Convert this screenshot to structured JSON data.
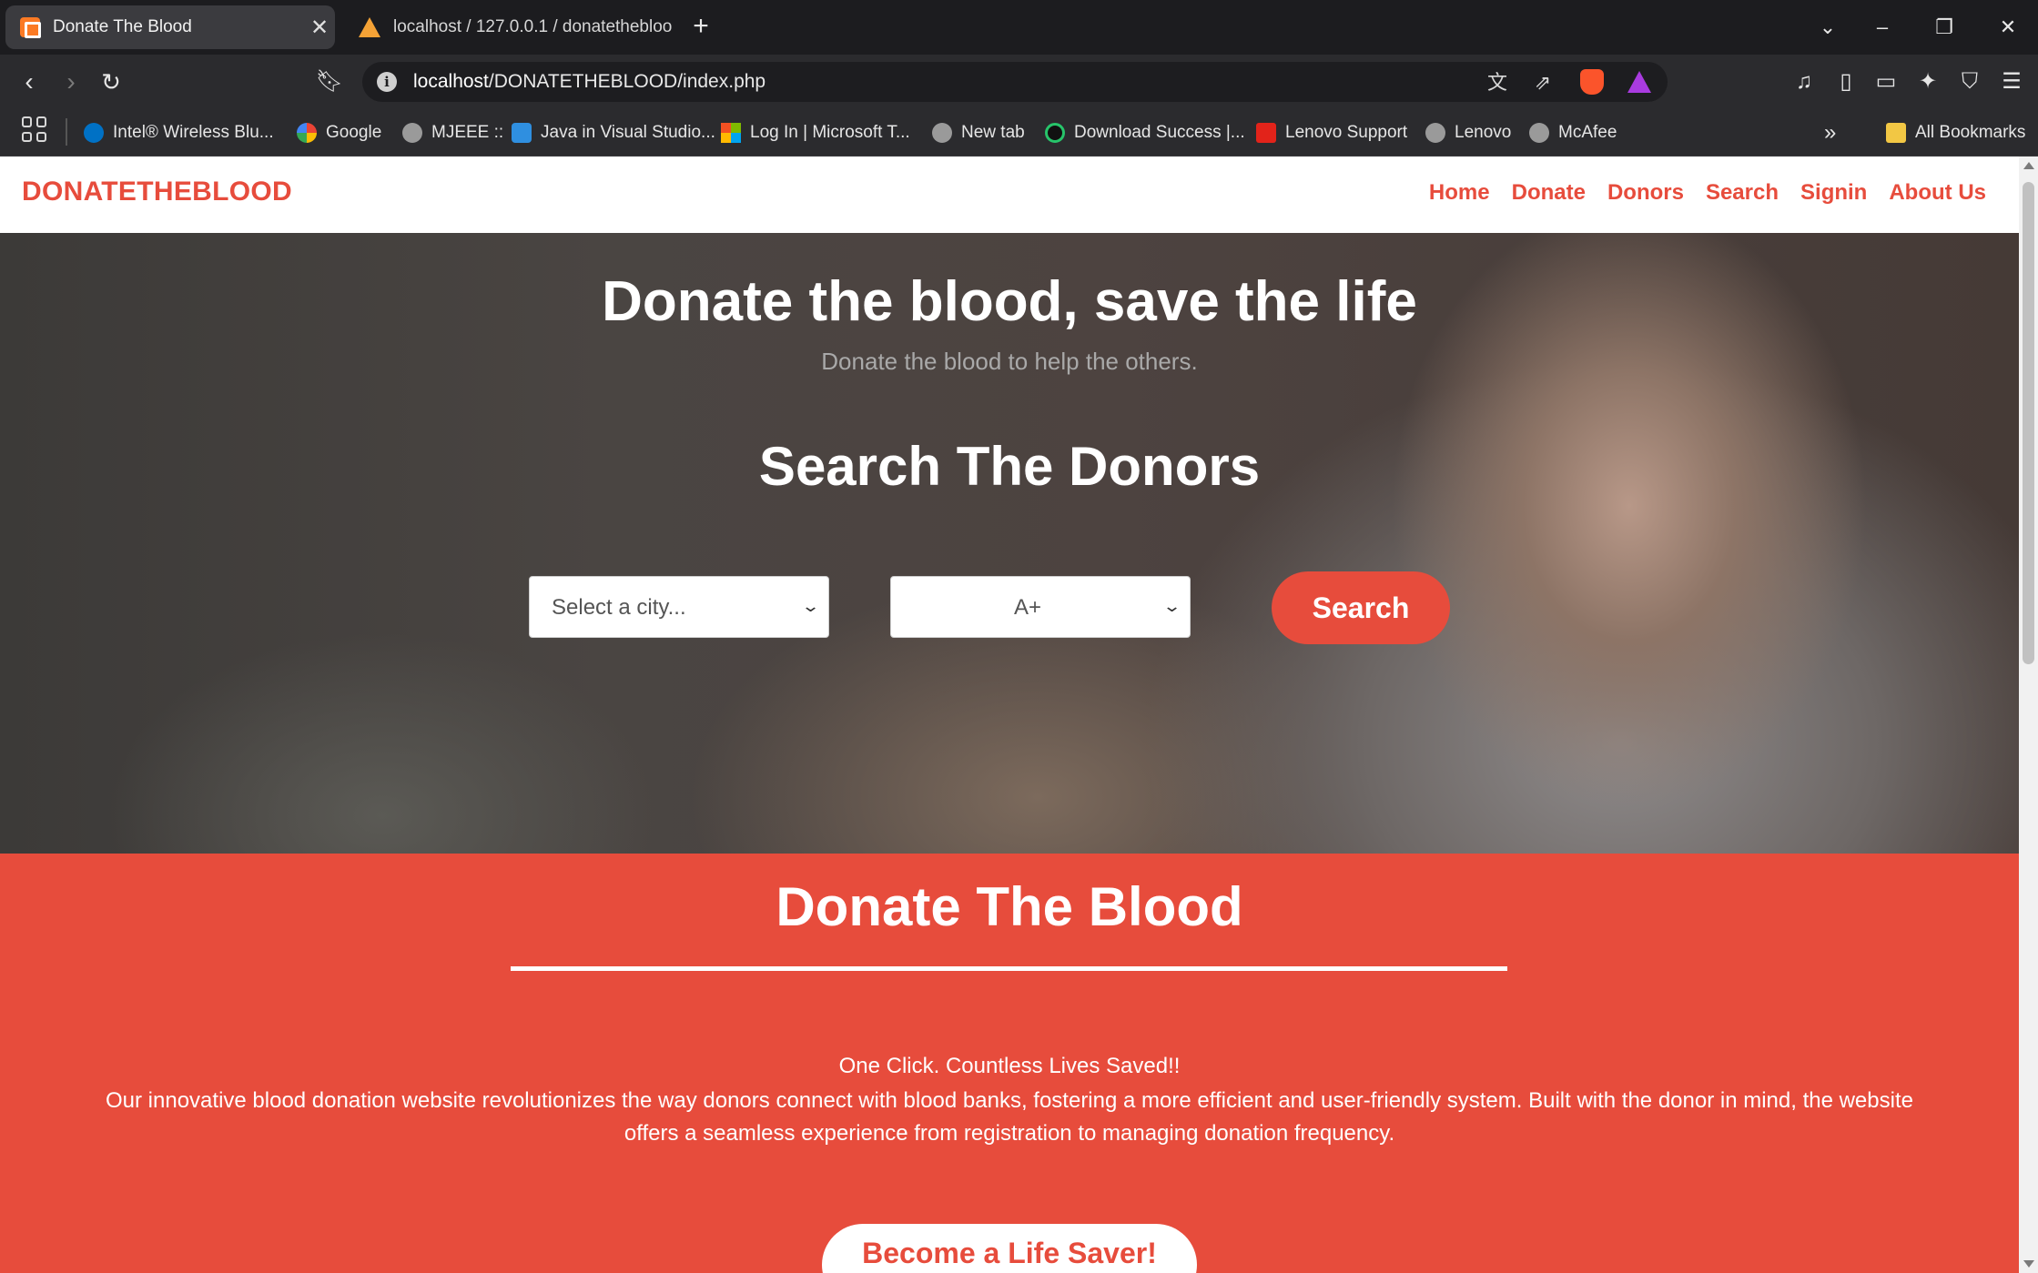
{
  "browser": {
    "tabs": [
      {
        "title": "Donate The Blood",
        "active": true
      },
      {
        "title": "localhost / 127.0.0.1 / donatethebloo",
        "active": false
      }
    ],
    "url_host": "localhost",
    "url_path": "/DONATETHEBLOOD/index.php",
    "bookmarks": [
      {
        "label": "Intel® Wireless Blu..."
      },
      {
        "label": "Google"
      },
      {
        "label": "MJEEE ::"
      },
      {
        "label": "Java in Visual Studio..."
      },
      {
        "label": "Log In | Microsoft T..."
      },
      {
        "label": "New tab"
      },
      {
        "label": "Download Success |..."
      },
      {
        "label": "Lenovo Support"
      },
      {
        "label": "Lenovo"
      },
      {
        "label": "McAfee"
      }
    ],
    "all_bookmarks_label": "All Bookmarks",
    "icons": {
      "back": "back-arrow-icon",
      "forward": "forward-arrow-icon",
      "reload": "reload-icon",
      "bookmark": "bookmark-icon",
      "translate": "translate-icon",
      "share": "share-icon",
      "brave": "brave-shields-icon",
      "rewards": "brave-rewards-icon"
    }
  },
  "site": {
    "brand": "DONATETHEBLOOD",
    "nav": [
      "Home",
      "Donate",
      "Donors",
      "Search",
      "Signin",
      "About Us"
    ],
    "hero": {
      "title": "Donate the blood, save the life",
      "subtitle": "Donate the blood to help the others.",
      "search_title": "Search The Donors",
      "city_select": "Select a city...",
      "blood_select": "A+",
      "search_button": "Search"
    },
    "section": {
      "title": "Donate The Blood",
      "tagline": "One Click. Countless Lives Saved!!",
      "description": "Our innovative blood donation website revolutionizes the way donors connect with blood banks, fostering a more efficient and user-friendly system. Built with the donor in mind, the website offers a seamless experience from registration to managing donation frequency.",
      "cta": "Become a Life Saver!"
    }
  },
  "colors": {
    "brand_red": "#e74c3c",
    "white": "#ffffff"
  }
}
